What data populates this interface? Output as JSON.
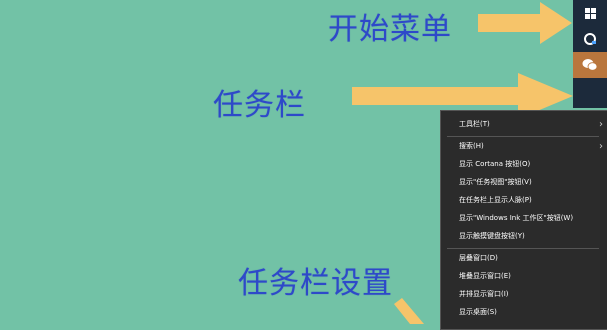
{
  "annotations": {
    "start_menu": "开始菜单",
    "taskbar": "任务栏",
    "taskbar_settings": "任务栏设置"
  },
  "colors": {
    "desktop_bg": "#72c2a6",
    "annotation_text": "#2e49c9",
    "arrow_fill": "#f6c46a",
    "taskbar_bg": "#1c2a3b",
    "menu_bg": "#2b2b2b"
  },
  "taskbar": {
    "icons": [
      "windows-start-icon",
      "cortana-icon",
      "wechat-icon"
    ]
  },
  "context_menu": {
    "items": [
      {
        "label": "工具栏(T)",
        "has_submenu": true
      },
      {
        "label": "搜索(H)",
        "has_submenu": true
      },
      {
        "label": "显示 Cortana 按钮(O)",
        "has_submenu": false
      },
      {
        "label": "显示\"任务视图\"按钮(V)",
        "has_submenu": false
      },
      {
        "label": "在任务栏上显示人脉(P)",
        "has_submenu": false
      },
      {
        "label": "显示\"Windows Ink 工作区\"按钮(W)",
        "has_submenu": false
      },
      {
        "label": "显示触摸键盘按钮(Y)",
        "has_submenu": false
      },
      {
        "label": "层叠窗口(D)",
        "has_submenu": false
      },
      {
        "label": "堆叠显示窗口(E)",
        "has_submenu": false
      },
      {
        "label": "并排显示窗口(I)",
        "has_submenu": false
      },
      {
        "label": "显示桌面(S)",
        "has_submenu": false
      }
    ],
    "submenu_glyph": "›"
  }
}
